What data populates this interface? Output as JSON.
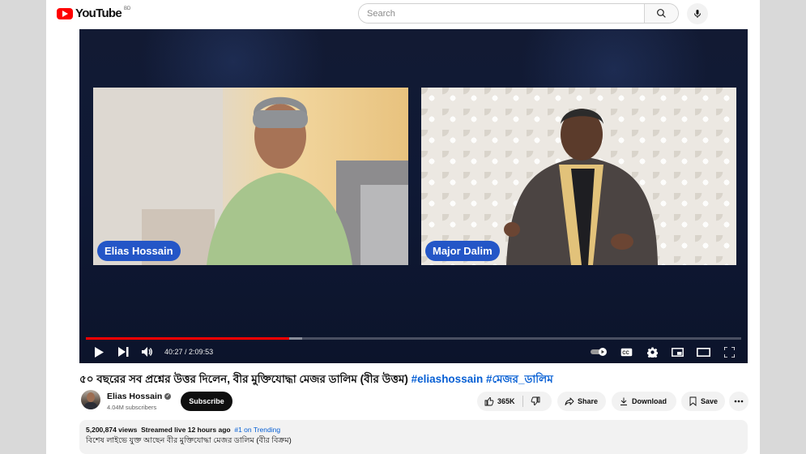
{
  "header": {
    "logo_text": "YouTube",
    "logo_region": "BD",
    "search_placeholder": "Search"
  },
  "player": {
    "tiles": [
      {
        "name": "Elias Hossain"
      },
      {
        "name": "Major Dalim"
      }
    ],
    "time_current": "40:27",
    "time_separator": " / ",
    "time_total": "2:09:53",
    "progress_played_fraction": 0.31,
    "progress_loaded_fraction": 0.33,
    "accent_color": "#ff0000",
    "name_tag_color": "#2456c7"
  },
  "video": {
    "title": "৫০ বছরের সব প্রশ্নের উত্তর দিলেন, বীর মুক্তিযোদ্ধা মেজর ডালিম (বীর উত্তম)",
    "hashtags": "#eliashossain #মেজর_ডালিম"
  },
  "channel": {
    "name": "Elias Hossain",
    "subscribers": "4.04M subscribers",
    "subscribe_label": "Subscribe"
  },
  "actions": {
    "like_count": "365K",
    "share_label": "Share",
    "download_label": "Download",
    "save_label": "Save"
  },
  "description": {
    "views": "5,200,874 views",
    "streamed": "Streamed live 12 hours ago",
    "trending": "#1 on Trending",
    "text": "বিশেষ লাইভে যুক্ত আছেন বীর মুক্তিযোদ্ধা মেজর ডালিম (বীর বিক্রম)"
  }
}
